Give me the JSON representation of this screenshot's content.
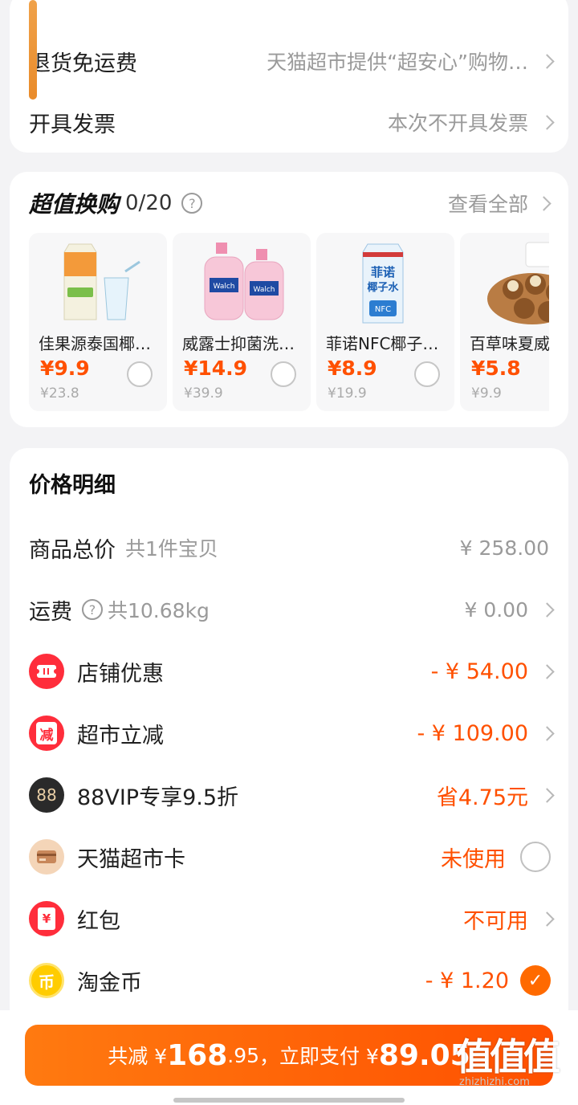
{
  "delivery": {
    "return_label": "退货免运费",
    "return_value": "天猫超市提供“超安心”购物…",
    "invoice_label": "开具发票",
    "invoice_value": "本次不开具发票"
  },
  "promo": {
    "title": "超值换购",
    "count": "0/20",
    "help": "?",
    "view_all": "查看全部",
    "products": [
      {
        "name": "佳果源泰国椰…",
        "price": "¥9.9",
        "orig": "¥23.8",
        "icon": "coconut-water-carton",
        "selected": false
      },
      {
        "name": "威露士抑菌洗…",
        "price": "¥14.9",
        "orig": "¥39.9",
        "icon": "hand-soap-bottles",
        "selected": false
      },
      {
        "name": "菲诺NFC椰子…",
        "price": "¥8.9",
        "orig": "¥19.9",
        "icon": "nfc-coconut-carton",
        "selected": false
      },
      {
        "name": "百草味夏威",
        "price": "¥5.8",
        "orig": "¥9.9",
        "icon": "macadamia-nuts",
        "selected": false
      }
    ]
  },
  "price_detail": {
    "title": "价格明细",
    "total_label": "商品总价",
    "total_sub": "共1件宝贝",
    "total_value": "¥ 258.00",
    "shipping_label": "运费",
    "shipping_help": "?",
    "shipping_sub": "共10.68kg",
    "shipping_value": "¥ 0.00",
    "rows": [
      {
        "label": "店铺优惠",
        "value": "- ¥ 54.00",
        "icon": "ticket-icon",
        "color": "#ff2d3b"
      },
      {
        "label": "超市立减",
        "value": "- ¥ 109.00",
        "icon": "reduce-icon",
        "icon_text": "减",
        "color": "#ff2d3b"
      },
      {
        "label": "88VIP专享9.5折",
        "value": "省4.75元",
        "icon": "vip88-icon",
        "icon_text": "88",
        "color": "#2a2a2a"
      },
      {
        "label": "天猫超市卡",
        "value": "未使用",
        "icon": "card-icon",
        "color": "#f4d5b8"
      },
      {
        "label": "红包",
        "value": "不可用",
        "icon": "redpacket-icon",
        "icon_text": "¥",
        "color": "#ff2d3b"
      },
      {
        "label": "淘金币",
        "value": "- ¥ 1.20",
        "icon": "coin-icon",
        "icon_text": "币",
        "color": "#ffcc00"
      }
    ]
  },
  "pay": {
    "reduce_prefix": "共减 ¥",
    "reduce_amount": "168",
    "reduce_decimal": ".95",
    "pay_prefix": "，立即支付 ¥",
    "pay_amount": "89.05",
    "accent": "#ff5000"
  },
  "watermark": {
    "logo": "值值值",
    "site": "zhizhizhi.com"
  }
}
